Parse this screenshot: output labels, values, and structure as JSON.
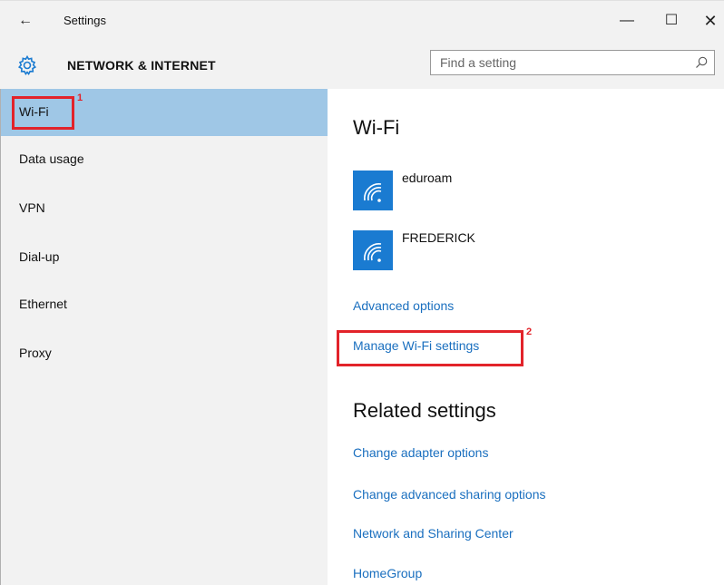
{
  "window": {
    "title": "Settings",
    "back_glyph": "←",
    "minimize_glyph": "—",
    "maximize_glyph": "☐",
    "close_glyph": "✕"
  },
  "header": {
    "title": "NETWORK & INTERNET",
    "search_placeholder": "Find a setting",
    "search_value": "",
    "gear_icon": "gear-icon",
    "search_icon": "search-icon"
  },
  "sidebar": {
    "items": [
      {
        "label": "Wi-Fi",
        "selected": true
      },
      {
        "label": "Data usage",
        "selected": false
      },
      {
        "label": "VPN",
        "selected": false
      },
      {
        "label": "Dial-up",
        "selected": false
      },
      {
        "label": "Ethernet",
        "selected": false
      },
      {
        "label": "Proxy",
        "selected": false
      }
    ]
  },
  "main": {
    "wifi_title": "Wi-Fi",
    "networks": [
      {
        "name": "eduroam",
        "icon": "wifi-icon"
      },
      {
        "name": "FREDERICK",
        "icon": "wifi-icon"
      }
    ],
    "advanced_options": "Advanced options",
    "manage_wifi": "Manage Wi-Fi settings",
    "related_title": "Related settings",
    "related_links": [
      "Change adapter options",
      "Change advanced sharing options",
      "Network and Sharing Center",
      "HomeGroup"
    ]
  },
  "annotations": [
    {
      "number": "1"
    },
    {
      "number": "2"
    }
  ],
  "colors": {
    "accent": "#1a7bd1",
    "link": "#1a6fbf",
    "selected_bg": "#9fc7e6",
    "annotation": "#e2232a"
  }
}
